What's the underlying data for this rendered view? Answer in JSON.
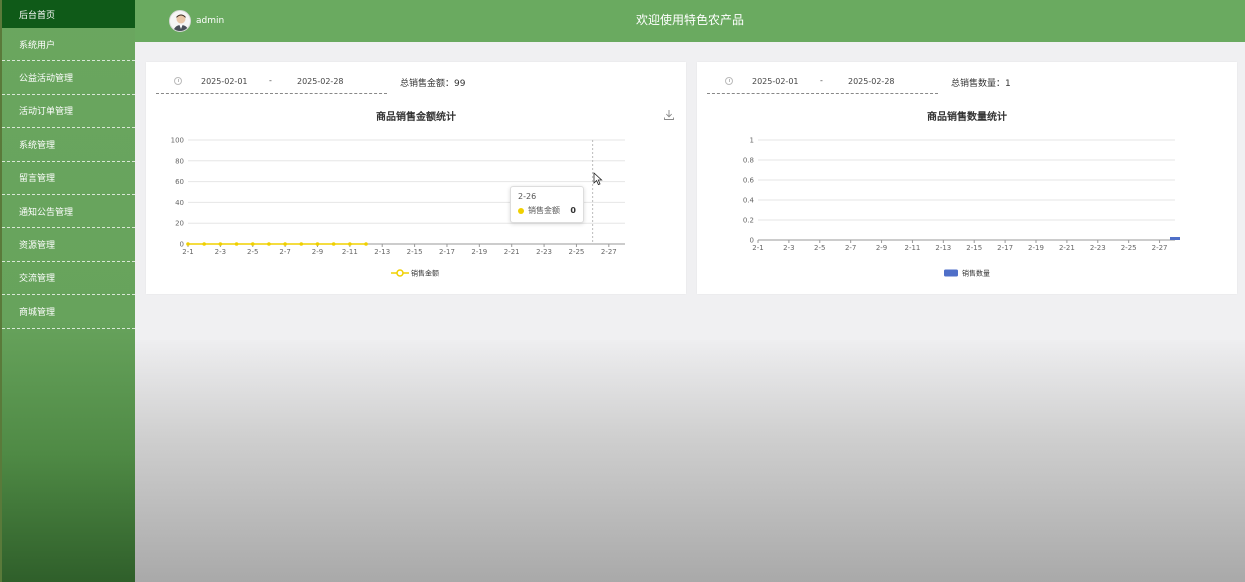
{
  "sidebar": {
    "items": [
      {
        "label": "后台首页",
        "active": true
      },
      {
        "label": "系统用户"
      },
      {
        "label": "公益活动管理"
      },
      {
        "label": "活动订单管理"
      },
      {
        "label": "系统管理"
      },
      {
        "label": "留言管理"
      },
      {
        "label": "通知公告管理"
      },
      {
        "label": "资源管理"
      },
      {
        "label": "交流管理"
      },
      {
        "label": "商城管理"
      }
    ]
  },
  "header": {
    "username": "admin",
    "title": "欢迎使用特色农产品"
  },
  "sales_amount_card": {
    "date_start": "2025-02-01",
    "date_separator": "-",
    "date_end": "2025-02-28",
    "total_label": "总销售金额：99",
    "tooltip": {
      "date": "2-26",
      "series": "销售金额",
      "value": "0"
    }
  },
  "sales_quantity_card": {
    "date_start": "2025-02-01",
    "date_separator": "-",
    "date_end": "2025-02-28",
    "total_label": "总销售数量：1"
  },
  "colors": {
    "header_green": "#6aaa60",
    "sidebar_active": "#0f5a18",
    "line_series": "#f0d000",
    "bar_series": "#4f6fc8"
  },
  "chart_data": [
    {
      "type": "line",
      "title": "商品销售金额统计",
      "x": [
        "2-1",
        "2-2",
        "2-3",
        "2-4",
        "2-5",
        "2-6",
        "2-7",
        "2-8",
        "2-9",
        "2-10",
        "2-11",
        "2-12",
        "2-13",
        "2-14",
        "2-15",
        "2-16",
        "2-17",
        "2-18",
        "2-19",
        "2-20",
        "2-21",
        "2-22",
        "2-23",
        "2-24",
        "2-25",
        "2-26",
        "2-27",
        "2-28"
      ],
      "x_tick_labels": [
        "2-1",
        "2-3",
        "2-5",
        "2-7",
        "2-9",
        "2-11",
        "2-13",
        "2-15",
        "2-17",
        "2-19",
        "2-21",
        "2-23",
        "2-25",
        "2-27"
      ],
      "series": [
        {
          "name": "销售金额",
          "values": [
            0,
            0,
            0,
            0,
            0,
            0,
            0,
            0,
            0,
            0,
            0,
            0,
            null,
            null,
            null,
            null,
            null,
            null,
            null,
            null,
            null,
            null,
            null,
            null,
            null,
            null,
            null,
            null
          ]
        }
      ],
      "ylim": [
        0,
        100
      ],
      "yticks": [
        0,
        20,
        40,
        60,
        80,
        100
      ],
      "grid": true,
      "legend": "bottom-center"
    },
    {
      "type": "bar",
      "title": "商品销售数量统计",
      "x": [
        "2-1",
        "2-2",
        "2-3",
        "2-4",
        "2-5",
        "2-6",
        "2-7",
        "2-8",
        "2-9",
        "2-10",
        "2-11",
        "2-12",
        "2-13",
        "2-14",
        "2-15",
        "2-16",
        "2-17",
        "2-18",
        "2-19",
        "2-20",
        "2-21",
        "2-22",
        "2-23",
        "2-24",
        "2-25",
        "2-26",
        "2-27",
        "2-28"
      ],
      "x_tick_labels": [
        "2-1",
        "2-3",
        "2-5",
        "2-7",
        "2-9",
        "2-11",
        "2-13",
        "2-15",
        "2-17",
        "2-19",
        "2-21",
        "2-23",
        "2-25",
        "2-27"
      ],
      "series": [
        {
          "name": "销售数量",
          "values": [
            0,
            0,
            0,
            0,
            0,
            0,
            0,
            0,
            0,
            0,
            0,
            0,
            0,
            0,
            0,
            0,
            0,
            0,
            0,
            0,
            0,
            0,
            0,
            0,
            0,
            0,
            0,
            0.03
          ]
        }
      ],
      "ylim": [
        0,
        1
      ],
      "yticks": [
        0,
        0.2,
        0.4,
        0.6,
        0.8,
        1
      ],
      "grid": true,
      "legend": "bottom-center"
    }
  ]
}
